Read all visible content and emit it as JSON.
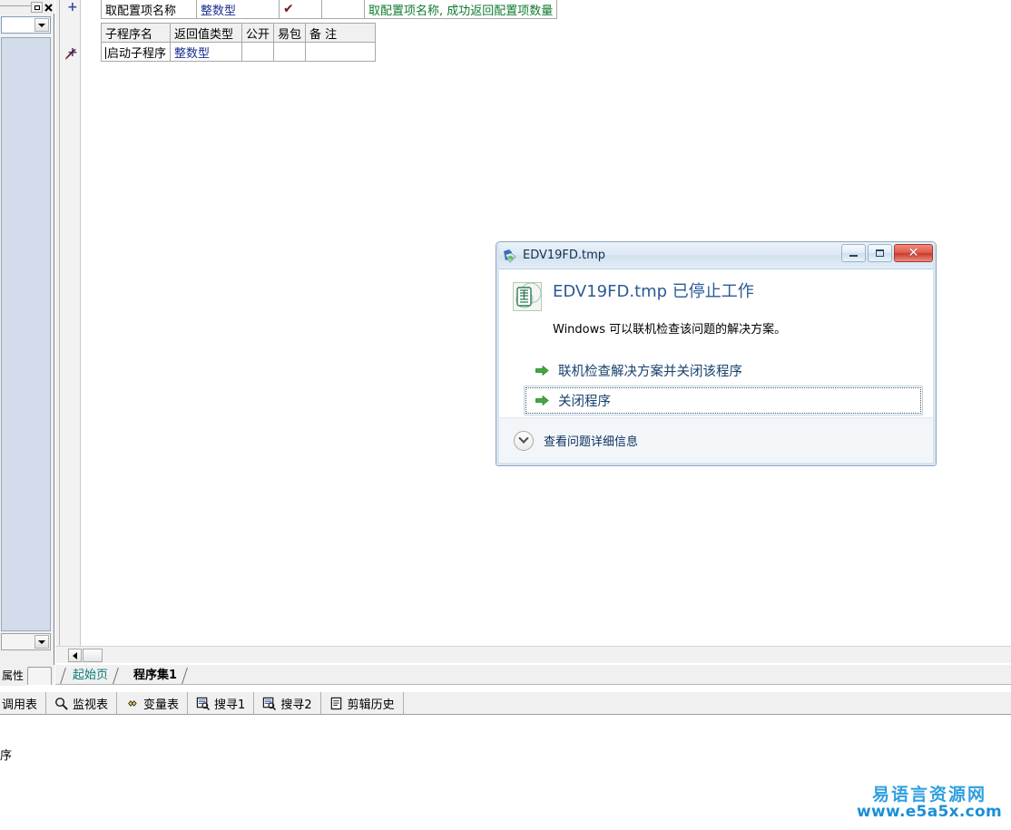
{
  "app": {
    "left_panel": {
      "restore_button": "□",
      "close_button": "×",
      "tab_label": "属性"
    },
    "interface_table": {
      "row": {
        "name": "取配置项名称",
        "return_type": "整数型",
        "public_mark": "✔",
        "package_mark": "",
        "comment": "取配置项名称, 成功返回配置项数量"
      }
    },
    "subroutine_table": {
      "headers": [
        "子程序名",
        "返回值类型",
        "公开",
        "易包",
        "备 注"
      ],
      "rows": [
        {
          "name": "启动子程序",
          "return_type": "整数型",
          "public": "",
          "package": "",
          "comment": ""
        }
      ]
    },
    "document_tabs": [
      {
        "label": "起始页",
        "active": false
      },
      {
        "label": "程序集1",
        "active": true
      }
    ],
    "tool_strip": [
      {
        "label": "调用表",
        "icon": "none"
      },
      {
        "label": "监视表",
        "icon": "magnifier-icon"
      },
      {
        "label": "变量表",
        "icon": "diamonds-icon"
      },
      {
        "label": "搜寻1",
        "icon": "search-window-icon"
      },
      {
        "label": "搜寻2",
        "icon": "search-window-icon"
      },
      {
        "label": "剪辑历史",
        "icon": "clipboard-icon"
      }
    ],
    "output_text": "序",
    "expand_markers": [
      "+",
      "+"
    ]
  },
  "crash_dialog": {
    "title": "EDV19FD.tmp",
    "window_buttons": {
      "minimize": "–",
      "maximize": "□",
      "close": "✕"
    },
    "headline": "EDV19FD.tmp 已停止工作",
    "subtext": "Windows 可以联机检查该问题的解决方案。",
    "actions": [
      {
        "label": "联机检查解决方案并关闭该程序",
        "focused": false
      },
      {
        "label": "关闭程序",
        "focused": true
      }
    ],
    "footer_label": "查看问题详细信息"
  },
  "watermark": {
    "chinese": "易语言资源网",
    "url": "www.e5a5x.com"
  },
  "colors": {
    "headline_blue": "#2b5a96",
    "arrow_green": "#2e9b2e",
    "comment_green": "#0f7a2e",
    "type_blue": "#1b2f8f",
    "check_dark_red": "#7a1717",
    "tab_teal": "#0a7b7b",
    "watermark_blue": "#2f9fe0",
    "panel_grid_blue": "#d3dcea"
  }
}
